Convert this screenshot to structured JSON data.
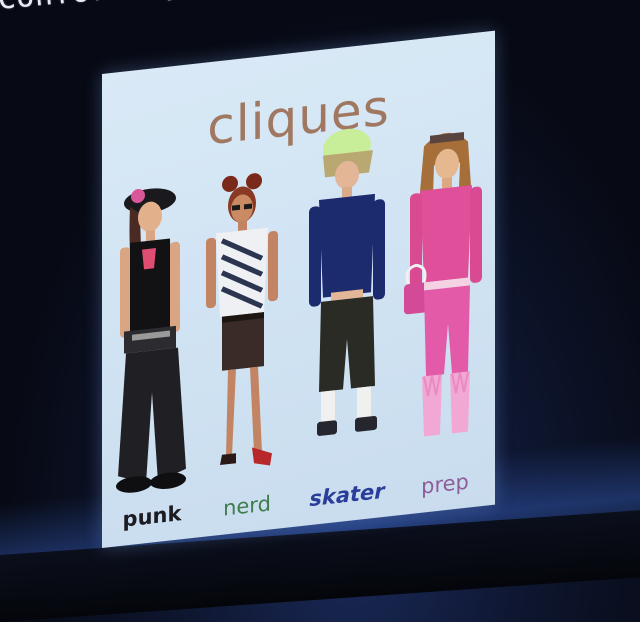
{
  "heading": "Conformity:  Real",
  "slide": {
    "title": "cliques",
    "cliques": [
      {
        "label": "punk",
        "label_color": "#1b1b22"
      },
      {
        "label": "nerd",
        "label_color": "#3f7d4c"
      },
      {
        "label": "skater",
        "label_color": "#2a3d9a"
      },
      {
        "label": "prep",
        "label_color": "#8e5d9a"
      }
    ]
  },
  "colors": {
    "slide_background": "#d4e6f4",
    "title_color": "#a07862",
    "screen_background": "#0a0d18"
  }
}
